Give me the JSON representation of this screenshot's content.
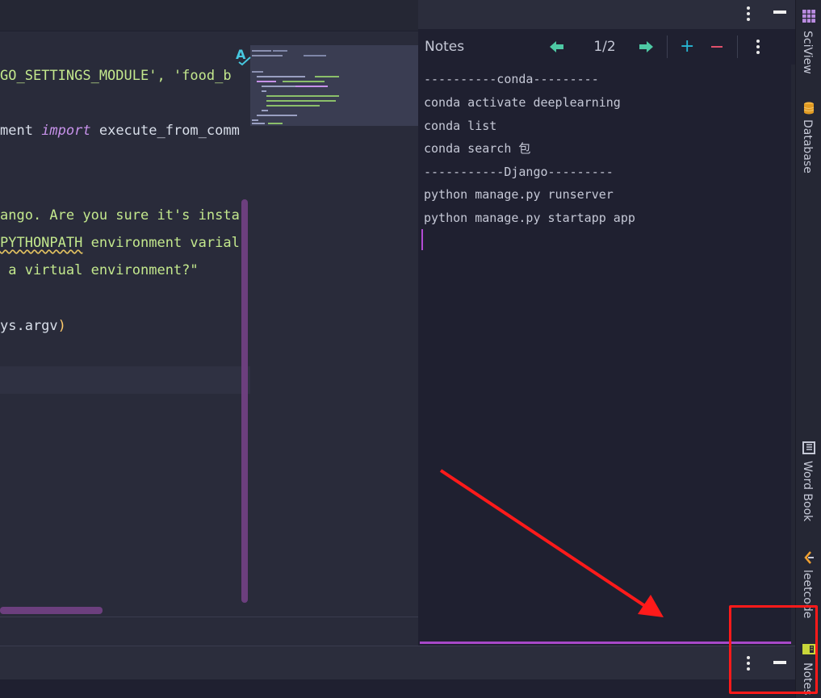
{
  "editor": {
    "lines": {
      "l1_str": "GO_SETTINGS_MODULE', 'food_b",
      "l2_a": "ment ",
      "l2_kw": "import",
      "l2_b": " execute_from_comm",
      "l3": "ango. Are you sure it's insta",
      "l4_sq": "PYTHONPATH",
      "l4_b": " environment varial",
      "l5": " a virtual environment?\"",
      "l6_a": "ys.argv",
      "l6_b": ")"
    }
  },
  "notes": {
    "title": "Notes",
    "page": "1/2",
    "lines": [
      "----------conda---------",
      "conda activate deeplearning",
      "conda list",
      "conda search 包",
      "-----------Django---------",
      "python manage.py runserver",
      "python manage.py startapp app"
    ]
  },
  "tool_strip": {
    "items": [
      {
        "label": "SciView",
        "icon": "grid-icon"
      },
      {
        "label": "Database",
        "icon": "database-icon"
      },
      {
        "label": "Word Book",
        "icon": "book-icon"
      },
      {
        "label": "leetcode",
        "icon": "leetcode-icon"
      },
      {
        "label": "Notes",
        "icon": "notes-icon"
      }
    ]
  },
  "colors": {
    "accent_purple": "#a748c8",
    "nav_arrow": "#4ec9a4",
    "add": "#28b5d3",
    "remove": "#e0506b",
    "annotation": "#ff1a1a"
  }
}
